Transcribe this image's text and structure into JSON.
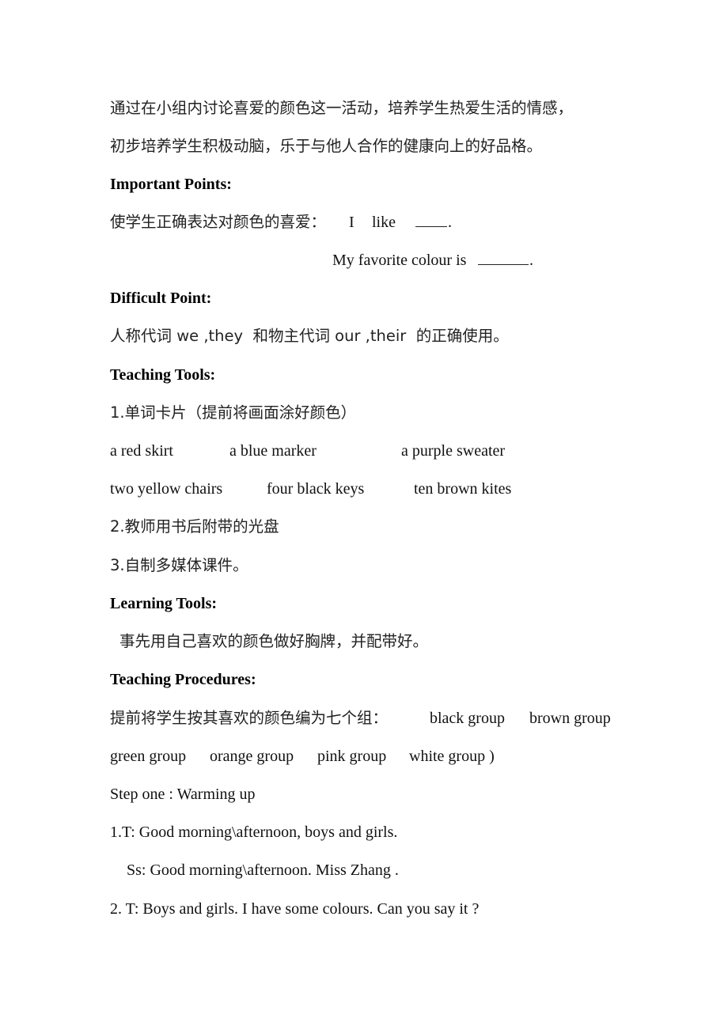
{
  "document": {
    "objective_lines": [
      "通过在小组内讨论喜爱的颜色这一活动，培养学生热爱生活的情感，",
      "初步培养学生积极动脑，乐于与他人合作的健康向上的好品格。"
    ],
    "important_points": {
      "heading": "Important Points:",
      "line1_cn": "使学生正确表达对颜色的喜爱：",
      "line1_en_a": "I",
      "line1_en_b": "like",
      "line1_end": ".",
      "line2_en": "My favorite colour is",
      "line2_end": "."
    },
    "difficult_point": {
      "heading": "Difficult Point:",
      "text": "人称代词 we ,they  和物主代词 our ,their  的正确使用。"
    },
    "teaching_tools": {
      "heading": "Teaching Tools:",
      "item1": "1.单词卡片（提前将画面涂好颜色）",
      "cards_row1": [
        "a red skirt",
        "a blue marker",
        "a purple sweater"
      ],
      "cards_row2": [
        "two yellow chairs",
        "four black keys",
        "ten brown kites"
      ],
      "item2": "2.教师用书后附带的光盘",
      "item3": "3.自制多媒体课件。"
    },
    "learning_tools": {
      "heading": "Learning Tools:",
      "text": "事先用自己喜欢的颜色做好胸牌，并配带好。"
    },
    "teaching_procedures": {
      "heading": "Teaching Procedures:",
      "groups_intro_cn": "提前将学生按其喜欢的颜色编为七个组：",
      "groups_row1": [
        "black group",
        "brown group"
      ],
      "groups_row2": [
        "green group",
        "orange group",
        "pink group",
        "white group )"
      ],
      "step_one": "Step one : Warming up",
      "dialogue": [
        "1.T: Good morning\\afternoon, boys and girls.",
        "Ss: Good morning\\afternoon. Miss Zhang .",
        "2. T: Boys and girls. I have some colours. Can you say it ?"
      ]
    }
  }
}
